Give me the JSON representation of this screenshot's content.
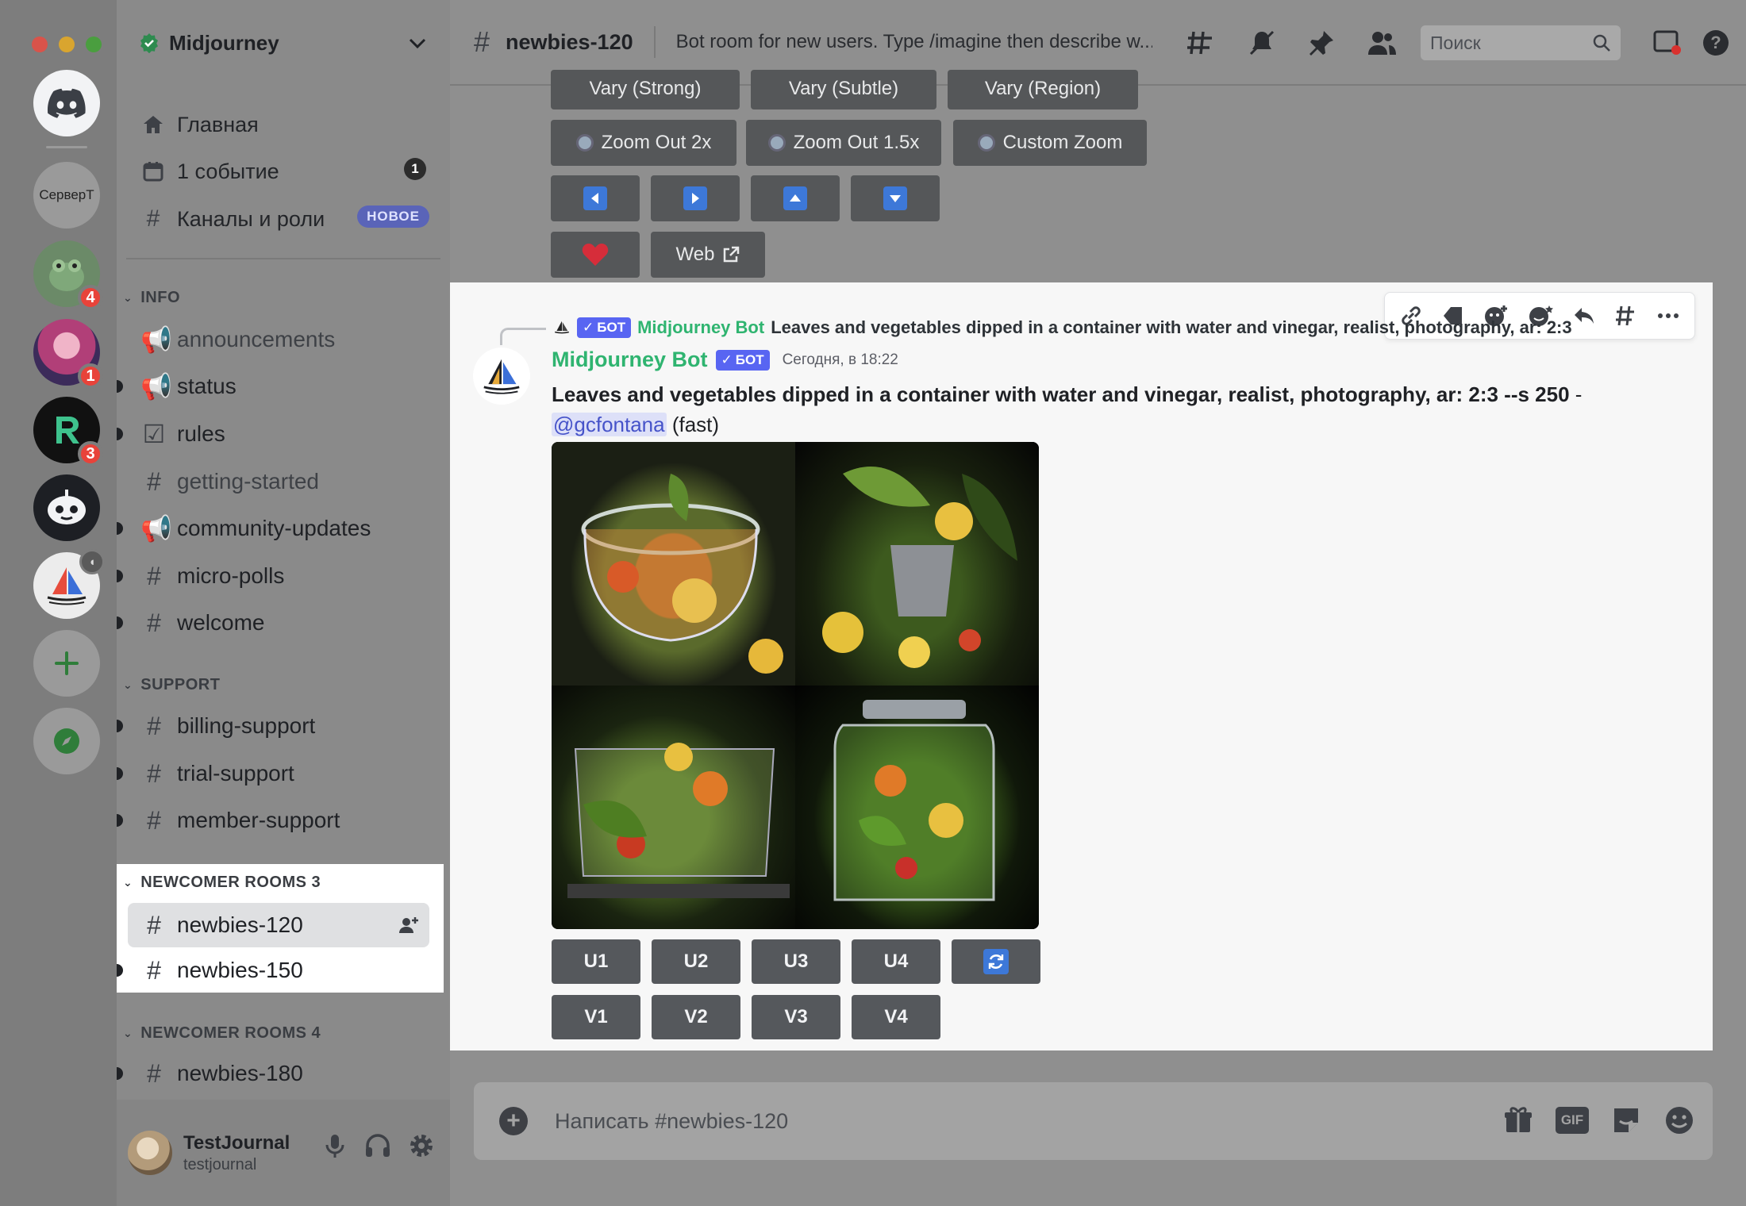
{
  "rail": {
    "server_text": "СерверТ",
    "badges": [
      "4",
      "1",
      "3"
    ]
  },
  "server": {
    "name": "Midjourney"
  },
  "nav": {
    "home": "Главная",
    "events": "1 событие",
    "events_count": "1",
    "channels_roles": "Каналы и роли",
    "new_badge": "НОВОЕ"
  },
  "categories": {
    "info": "INFO",
    "support": "SUPPORT",
    "newcomer3": "NEWCOMER ROOMS 3",
    "newcomer4": "NEWCOMER ROOMS 4"
  },
  "channels": {
    "info": [
      "announcements",
      "status",
      "rules",
      "getting-started",
      "community-updates",
      "micro-polls",
      "welcome"
    ],
    "support": [
      "billing-support",
      "trial-support",
      "member-support"
    ],
    "newcomer3": [
      "newbies-120",
      "newbies-150"
    ],
    "newcomer4": [
      "newbies-180"
    ]
  },
  "user": {
    "display": "TestJournal",
    "handle": "testjournal"
  },
  "topbar": {
    "channel": "newbies-120",
    "topic": "Bot room for new users. Type /imagine then describe w...",
    "search_placeholder": "Поиск"
  },
  "prev_buttons": {
    "vary_strong": "Vary (Strong)",
    "vary_subtle": "Vary (Subtle)",
    "vary_region": "Vary (Region)",
    "zoom2": "Zoom Out 2x",
    "zoom15": "Zoom Out 1.5x",
    "custom_zoom": "Custom Zoom",
    "web": "Web"
  },
  "message": {
    "reply_author": "Midjourney Bot",
    "reply_text": "Leaves and vegetables dipped in a container with water and vinegar, realist, photography, ar: 2:3",
    "bot_tag": "БОТ",
    "author": "Midjourney Bot",
    "timestamp": "Сегодня, в 18:22",
    "prompt": "Leaves and vegetables dipped in a container with water and vinegar, realist, photography, ar: 2:3 --s 250",
    "dash": " - ",
    "mention": "@gcfontana",
    "speed": " (fast)",
    "upscale": [
      "U1",
      "U2",
      "U3",
      "U4"
    ],
    "variation": [
      "V1",
      "V2",
      "V3",
      "V4"
    ]
  },
  "composer": {
    "placeholder": "Написать #newbies-120",
    "gif": "GIF"
  }
}
